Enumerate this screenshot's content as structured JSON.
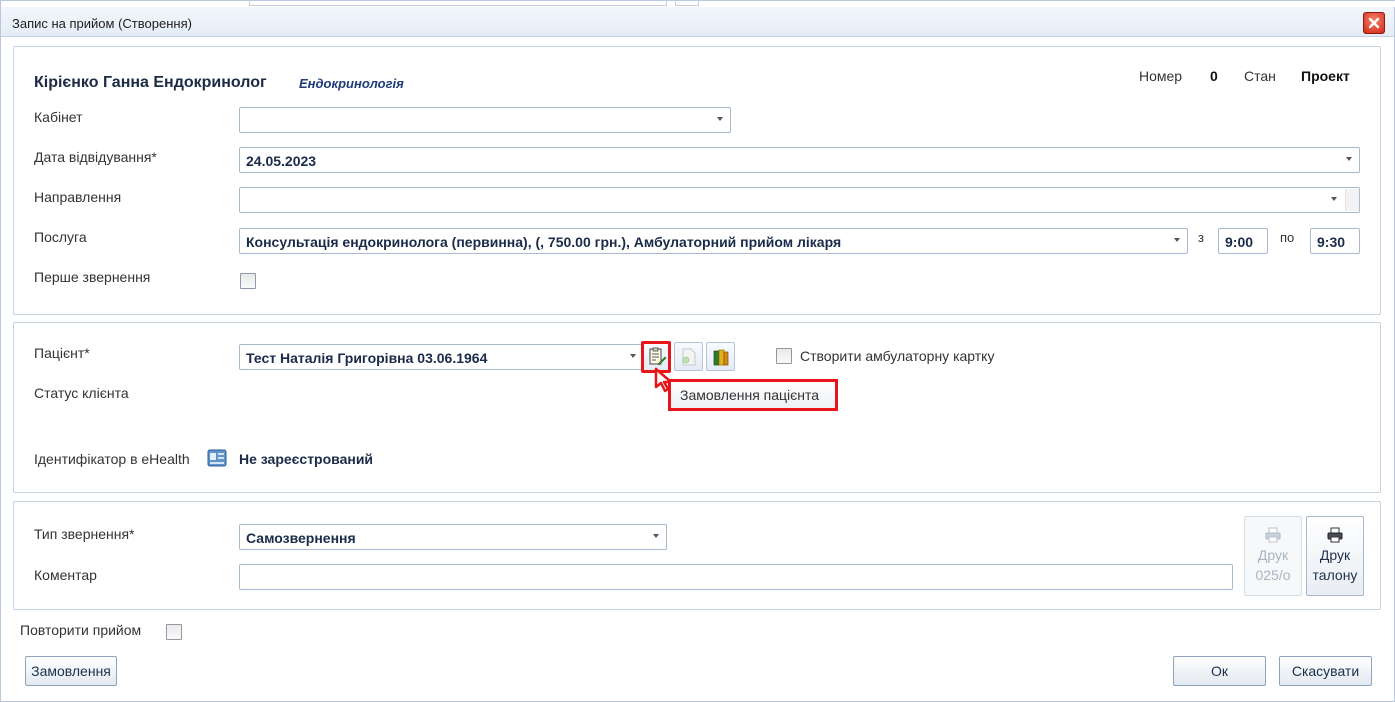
{
  "window": {
    "title": "Запис на прийом (Створення)"
  },
  "header": {
    "doctor": "Кірієнко Ганна Ендокринолог",
    "specialty": "Ендокринологія",
    "number_label": "Номер",
    "number_value": "0",
    "state_label": "Стан",
    "state_value": "Проект"
  },
  "form": {
    "cabinet": {
      "label": "Кабінет",
      "value": ""
    },
    "visit_date": {
      "label": "Дата відвідування*",
      "value": "24.05.2023"
    },
    "referral": {
      "label": "Направлення",
      "value": ""
    },
    "service": {
      "label": "Послуга",
      "value": "Консультація ендокринолога (первинна), (, 750.00 грн.), Амбулаторний прийом лікаря"
    },
    "time_from_label": "з",
    "time_from": "9:00",
    "time_to_label": "по",
    "time_to": "9:30",
    "first_visit": {
      "label": "Перше звернення",
      "checked": false
    }
  },
  "patient": {
    "label": "Пацієнт*",
    "value": "Тест Наталія Григорівна 03.06.1964",
    "create_card_label": "Створити амбулаторну картку",
    "tooltip": "Замовлення пацієнта",
    "client_status_label": "Статус клієнта",
    "ehealth_label": "Ідентифікатор в eHealth",
    "ehealth_status": "Не зареєстрований"
  },
  "appeal": {
    "type_label": "Тип звернення*",
    "type_value": "Самозвернення",
    "comment_label": "Коментар",
    "comment_value": "",
    "print_025_line1": "Друк",
    "print_025_line2": "025/о",
    "print_ticket_line1": "Друк",
    "print_ticket_line2": "талону"
  },
  "footer": {
    "repeat_label": "Повторити прийом",
    "orders_button": "Замовлення",
    "ok_button": "Ок",
    "cancel_button": "Скасувати"
  },
  "colors": {
    "highlight": "#e8141a",
    "close_button": "#cf2b17",
    "accent_text": "#1f3c7a"
  },
  "icons": [
    "close-icon",
    "patient-order-icon",
    "document-add-icon",
    "books-icon",
    "ehealth-card-icon",
    "printer-icon",
    "tooltip-pointer-icon"
  ]
}
